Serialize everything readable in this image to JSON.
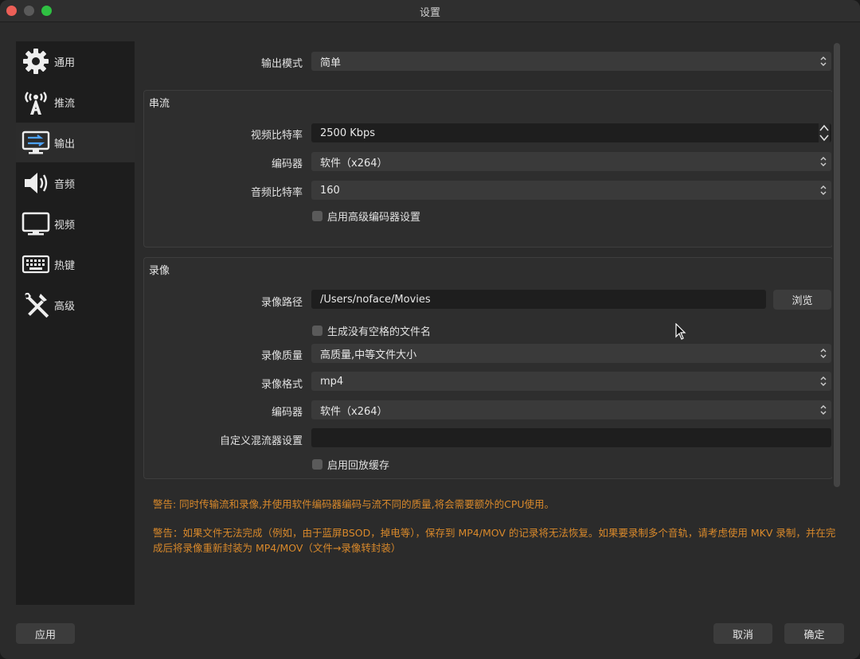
{
  "window": {
    "title": "设置"
  },
  "sidebar": {
    "items": [
      {
        "label": "通用",
        "icon": "gear-icon"
      },
      {
        "label": "推流",
        "icon": "broadcast-icon"
      },
      {
        "label": "输出",
        "icon": "output-icon",
        "active": true
      },
      {
        "label": "音频",
        "icon": "speaker-icon"
      },
      {
        "label": "视频",
        "icon": "monitor-icon"
      },
      {
        "label": "热键",
        "icon": "keyboard-icon"
      },
      {
        "label": "高级",
        "icon": "tools-icon"
      }
    ]
  },
  "output_mode": {
    "label": "输出模式",
    "value": "简单"
  },
  "streaming": {
    "title": "串流",
    "video_bitrate": {
      "label": "视频比特率",
      "value": "2500 Kbps"
    },
    "encoder": {
      "label": "编码器",
      "value": "软件（x264）"
    },
    "audio_bitrate": {
      "label": "音频比特率",
      "value": "160"
    },
    "advanced_encoder": {
      "label": "启用高级编码器设置"
    }
  },
  "recording": {
    "title": "录像",
    "path": {
      "label": "录像路径",
      "value": "/Users/noface/Movies",
      "browse_label": "浏览"
    },
    "no_space": {
      "label": "生成没有空格的文件名"
    },
    "quality": {
      "label": "录像质量",
      "value": "高质量,中等文件大小"
    },
    "format": {
      "label": "录像格式",
      "value": "mp4"
    },
    "encoder": {
      "label": "编码器",
      "value": "软件（x264）"
    },
    "muxer": {
      "label": "自定义混流器设置",
      "value": ""
    },
    "replay_buffer": {
      "label": "启用回放缓存"
    }
  },
  "warnings": {
    "w1": "警告: 同时传输流和录像,并使用软件编码器编码与流不同的质量,将会需要额外的CPU使用。",
    "w2": "警告：如果文件无法完成（例如，由于蓝屏BSOD，掉电等），保存到 MP4/MOV 的记录将无法恢复。如果要录制多个音轨，请考虑使用 MKV 录制，并在完成后将录像重新封装为 MP4/MOV（文件→录像转封装）"
  },
  "footer": {
    "apply": "应用",
    "cancel": "取消",
    "ok": "确定"
  },
  "colors": {
    "warning": "#d9892b",
    "window_bg": "#2b2b2b",
    "sidebar_bg": "#1d1d1d"
  }
}
